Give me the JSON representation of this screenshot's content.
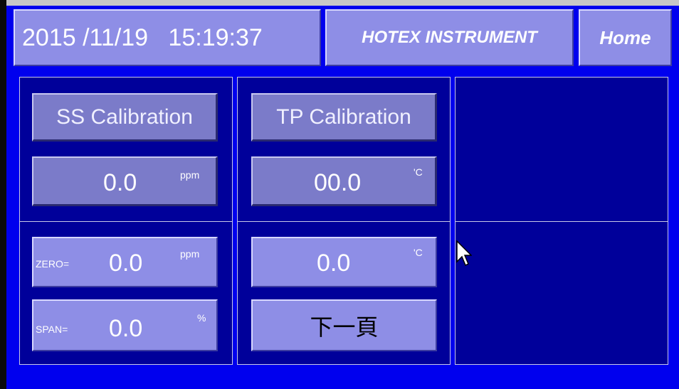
{
  "header": {
    "datetime": "2015 /11/19   15:19:37",
    "brand": "HOTEX INSTRUMENT",
    "home_label": "Home"
  },
  "ss": {
    "title": "SS Calibration",
    "reading": "0.0",
    "reading_unit": "ppm",
    "zero_label": "ZERO=",
    "zero_value": "0.0",
    "zero_unit": "ppm",
    "span_label": "SPAN=",
    "span_value": "0.0",
    "span_unit": "%"
  },
  "tp": {
    "title": "TP Calibration",
    "reading": "00.0",
    "reading_unit": "'C",
    "setpoint": "0.0",
    "setpoint_unit": "'C",
    "next_page": "下一頁"
  },
  "colors": {
    "screen_bg": "#0000ee",
    "panel_bg": "#00009a",
    "button_face": "#8e8ee6"
  },
  "icons": {
    "cursor": "mouse-pointer-icon"
  }
}
